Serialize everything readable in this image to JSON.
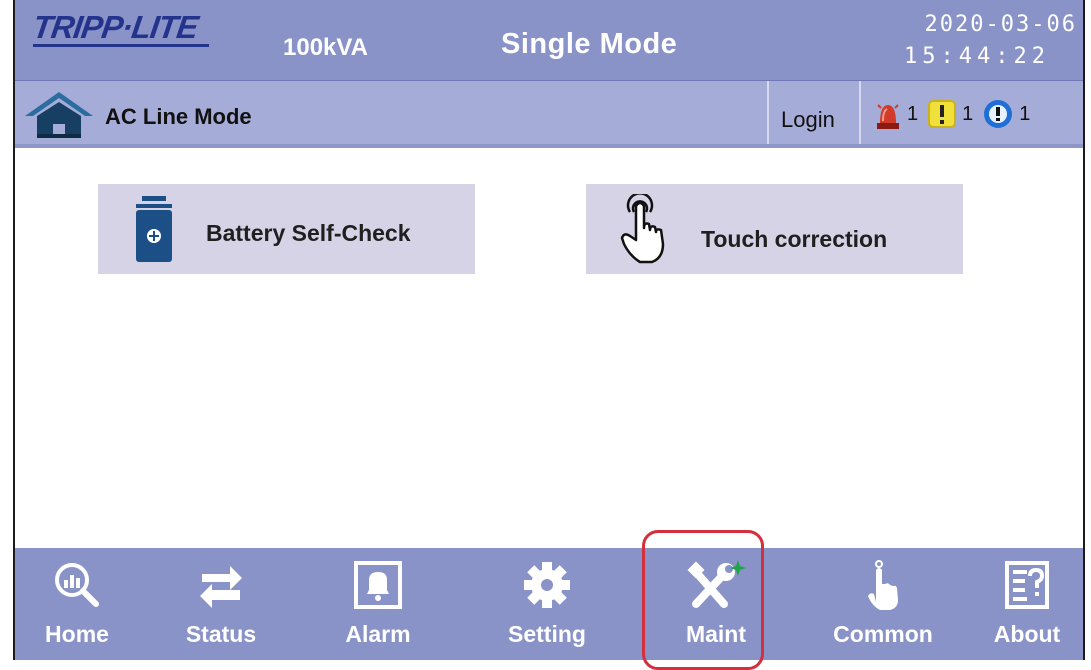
{
  "header": {
    "brand": "TRIPP·LITE",
    "capacity": "100kVA",
    "mode": "Single Mode",
    "date": "2020-03-06",
    "time": "15:44:22"
  },
  "status": {
    "line_mode": "AC Line Mode",
    "login_label": "Login",
    "alarms": [
      {
        "icon": "siren-icon",
        "count": "1",
        "color": "#d23a2a"
      },
      {
        "icon": "warning-icon",
        "count": "1",
        "color": "#f2e03a"
      },
      {
        "icon": "info-icon",
        "count": "1",
        "color": "#1f6fd6"
      }
    ]
  },
  "main": {
    "buttons": [
      {
        "label": "Battery Self-Check",
        "icon": "battery-icon"
      },
      {
        "label": "Touch correction",
        "icon": "touch-hand-icon"
      }
    ]
  },
  "nav": {
    "items": [
      {
        "label": "Home",
        "icon": "home-chart-icon"
      },
      {
        "label": "Status",
        "icon": "arrows-icon"
      },
      {
        "label": "Alarm",
        "icon": "bell-icon"
      },
      {
        "label": "Setting",
        "icon": "gear-icon"
      },
      {
        "label": "Maint",
        "icon": "wrench-icon",
        "selected": true
      },
      {
        "label": "Common",
        "icon": "pointer-icon"
      },
      {
        "label": "About",
        "icon": "help-document-icon"
      }
    ]
  },
  "colors": {
    "header_bg": "#8a93c8",
    "status_bg": "#a6acd8",
    "button_bg": "#d5d3e5",
    "highlight": "#d32f3c"
  }
}
